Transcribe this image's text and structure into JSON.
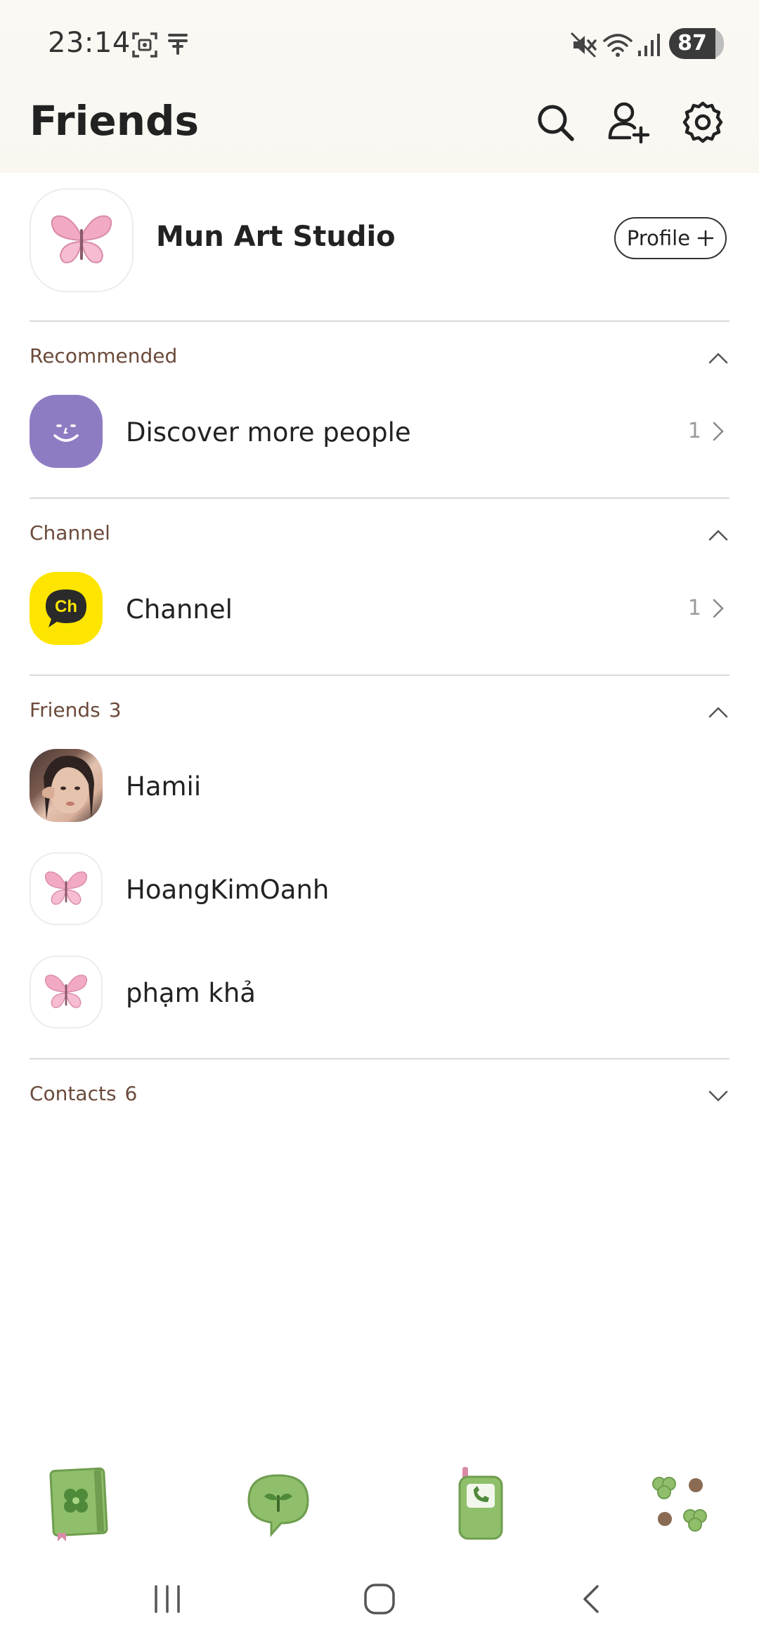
{
  "status_bar": {
    "time": "23:14",
    "battery": "87"
  },
  "header": {
    "title": "Friends"
  },
  "profile": {
    "name": "Mun Art Studio",
    "button_label": "Profile"
  },
  "sections": {
    "recommended": {
      "label": "Recommended",
      "item": {
        "name": "Discover more people",
        "count": "1"
      }
    },
    "channel": {
      "label": "Channel",
      "item": {
        "name": "Channel",
        "count": "1",
        "logo_text": "Ch"
      }
    },
    "friends": {
      "label": "Friends",
      "count": "3",
      "items": [
        {
          "name": "Hamii"
        },
        {
          "name": "HoangKimOanh"
        },
        {
          "name": "phạm khả"
        }
      ]
    },
    "contacts": {
      "label": "Contacts",
      "count": "6"
    }
  },
  "bottom_nav": {
    "icons": [
      "friends-book-icon",
      "chat-bubble-icon",
      "phone-icon",
      "more-clover-icon"
    ]
  },
  "colors": {
    "accent_purple": "#8e7cc3",
    "channel_yellow": "#fee500",
    "label_brown": "#6b4a3a",
    "nav_green": "#8fbf6a"
  }
}
